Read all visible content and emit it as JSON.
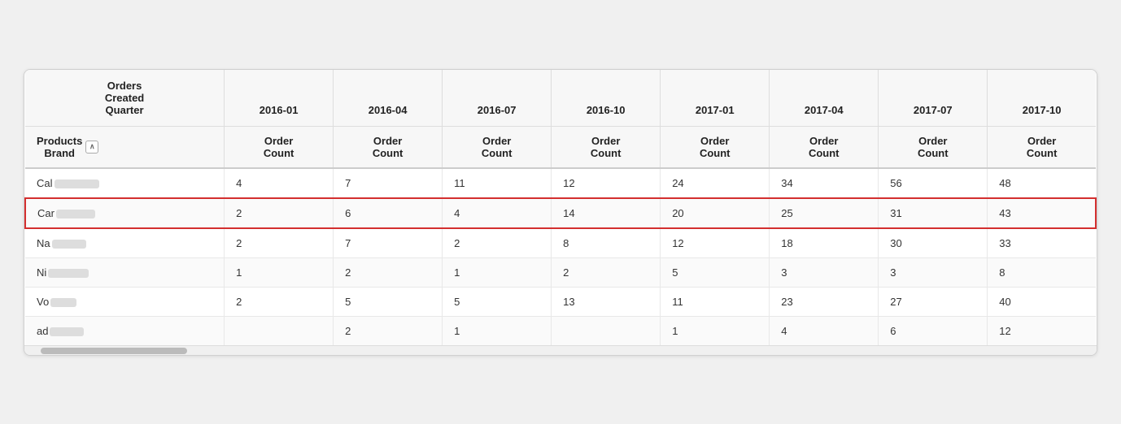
{
  "table": {
    "top_header": {
      "first_col": "Orders\nCreated\nQuarter",
      "columns": [
        "2016-01",
        "2016-04",
        "2016-07",
        "2016-10",
        "2017-01",
        "2017-04",
        "2017-07",
        "2017-10"
      ]
    },
    "sub_header": {
      "first_col": "Products\nBrand",
      "sort_icon": "^",
      "col_label": "Order\nCount"
    },
    "rows": [
      {
        "brand": "Cal",
        "blurred": true,
        "highlighted": false,
        "values": [
          "4",
          "7",
          "11",
          "12",
          "24",
          "34",
          "56",
          "48"
        ]
      },
      {
        "brand": "Car",
        "blurred": true,
        "highlighted": true,
        "values": [
          "2",
          "6",
          "4",
          "14",
          "20",
          "25",
          "31",
          "43"
        ]
      },
      {
        "brand": "Na",
        "blurred": true,
        "highlighted": false,
        "values": [
          "2",
          "7",
          "2",
          "8",
          "12",
          "18",
          "30",
          "33"
        ]
      },
      {
        "brand": "Ni",
        "blurred": true,
        "highlighted": false,
        "values": [
          "1",
          "2",
          "1",
          "2",
          "5",
          "3",
          "3",
          "8"
        ]
      },
      {
        "brand": "Vo",
        "blurred": true,
        "highlighted": false,
        "values": [
          "2",
          "5",
          "5",
          "13",
          "11",
          "23",
          "27",
          "40"
        ]
      },
      {
        "brand": "ad",
        "blurred": true,
        "highlighted": false,
        "values": [
          "",
          "2",
          "1",
          "",
          "1",
          "4",
          "6",
          "12"
        ]
      }
    ],
    "blurred_widths": [
      60,
      50,
      40,
      50,
      30,
      40,
      50,
      40,
      40,
      60
    ]
  }
}
